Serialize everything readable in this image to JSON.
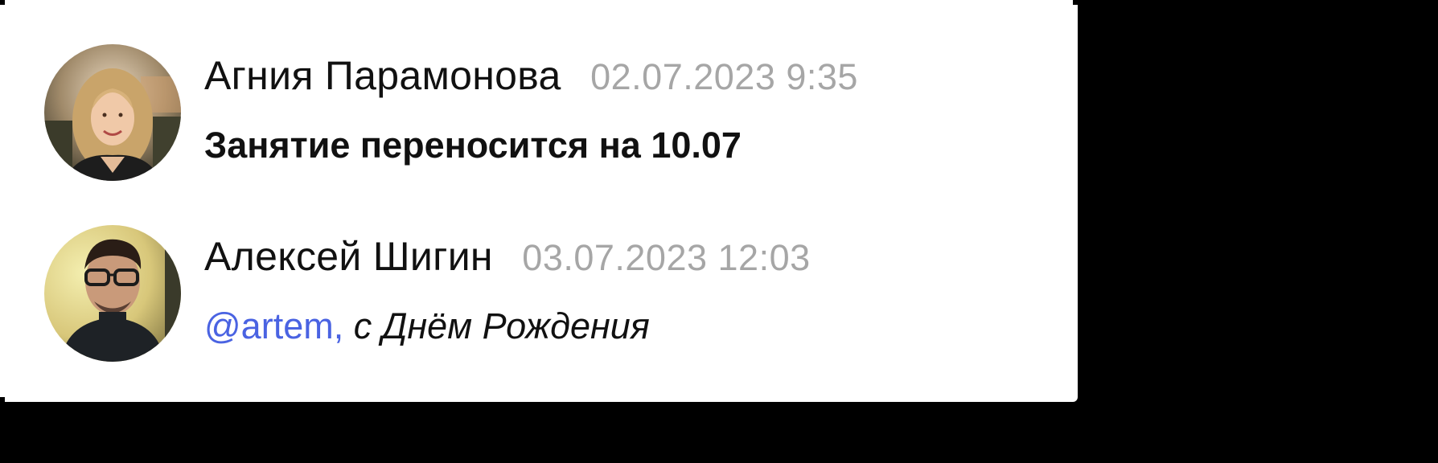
{
  "messages": [
    {
      "author": "Агния Парамонова",
      "timestamp": "02.07.2023 9:35",
      "text": "Занятие переносится на 10.07",
      "avatar": "woman-avatar"
    },
    {
      "author": "Алексей Шигин",
      "timestamp": "03.07.2023 12:03",
      "mention": "@artem,",
      "text": "с Днём Рождения",
      "avatar": "man-avatar"
    }
  ],
  "colors": {
    "background": "#000000",
    "card": "#ffffff",
    "author": "#111111",
    "timestamp": "#a6a6a6",
    "mention": "#4a63e2"
  }
}
